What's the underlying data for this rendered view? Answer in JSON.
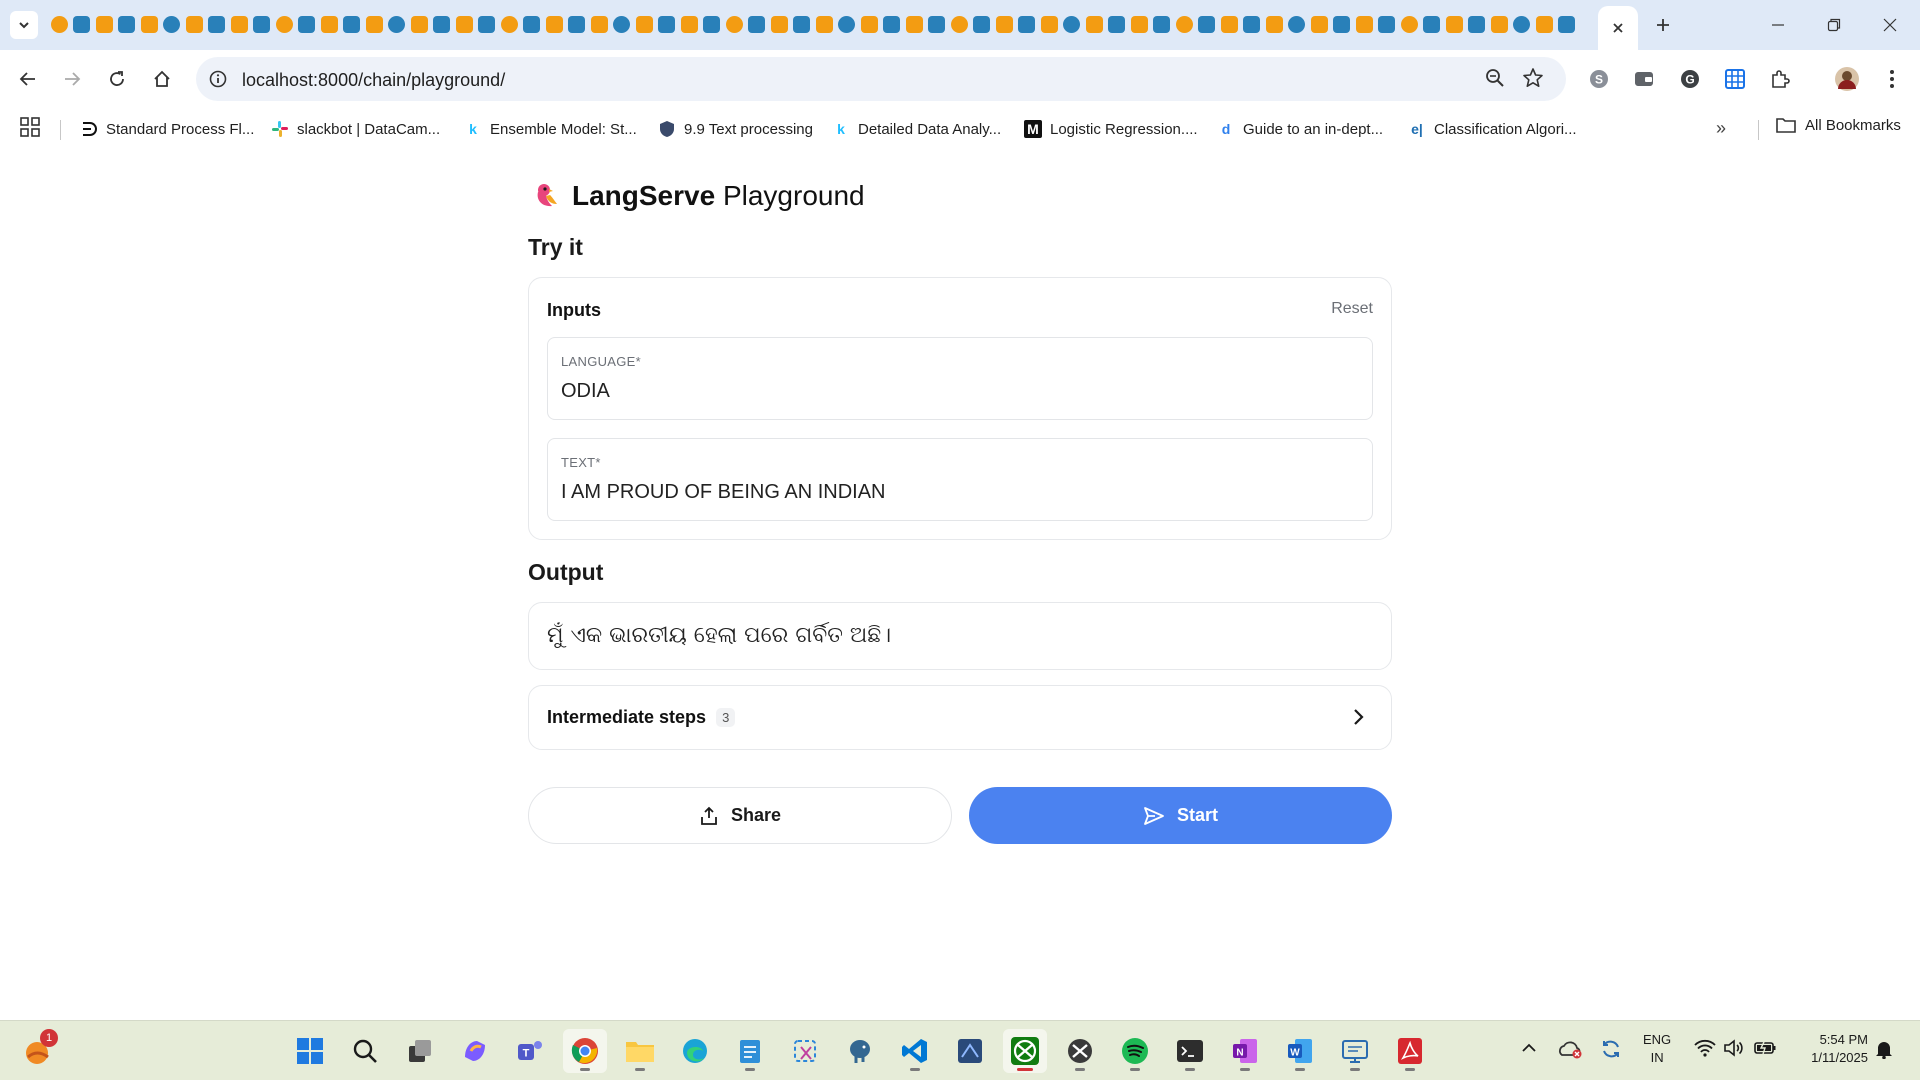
{
  "browser": {
    "url": "localhost:8000/chain/playground/",
    "bookmarks": [
      {
        "label": "Standard Process Fl...",
        "icon": "ds-icon"
      },
      {
        "label": "slackbot | DataCam...",
        "icon": "slack-icon"
      },
      {
        "label": "Ensemble Model: St...",
        "icon": "k-icon"
      },
      {
        "label": "9.9 Text processing",
        "icon": "shield-icon"
      },
      {
        "label": "Detailed Data Analy...",
        "icon": "k-icon"
      },
      {
        "label": "Logistic Regression....",
        "icon": "medium-icon"
      },
      {
        "label": "Guide to an in-dept...",
        "icon": "d-icon"
      },
      {
        "label": "Classification Algori...",
        "icon": "e-icon"
      }
    ],
    "all_bookmarks_label": "All Bookmarks"
  },
  "app": {
    "brand_bold": "LangServe",
    "brand_rest": " Playground",
    "try_heading": "Try it",
    "inputs_heading": "Inputs",
    "reset_label": "Reset",
    "fields": [
      {
        "label": "LANGUAGE*",
        "value": "ODIA"
      },
      {
        "label": "TEXT*",
        "value": "I AM PROUD OF BEING AN INDIAN"
      }
    ],
    "output_heading": "Output",
    "output_text": "ମୁଁ ଏକ ଭାରତୀୟ ହେଲା ପରେ ଗର୍ବିତ ଅଛି।",
    "steps_label": "Intermediate steps",
    "steps_count": "3",
    "share_label": "Share",
    "start_label": "Start"
  },
  "taskbar": {
    "weather_badge": "1",
    "lang_line1": "ENG",
    "lang_line2": "IN",
    "time": "5:54 PM",
    "date": "1/11/2025"
  },
  "colors": {
    "accent": "#4b82f0",
    "tabstrip": "#dfe9f7",
    "taskbar": "#e6ecd8"
  }
}
